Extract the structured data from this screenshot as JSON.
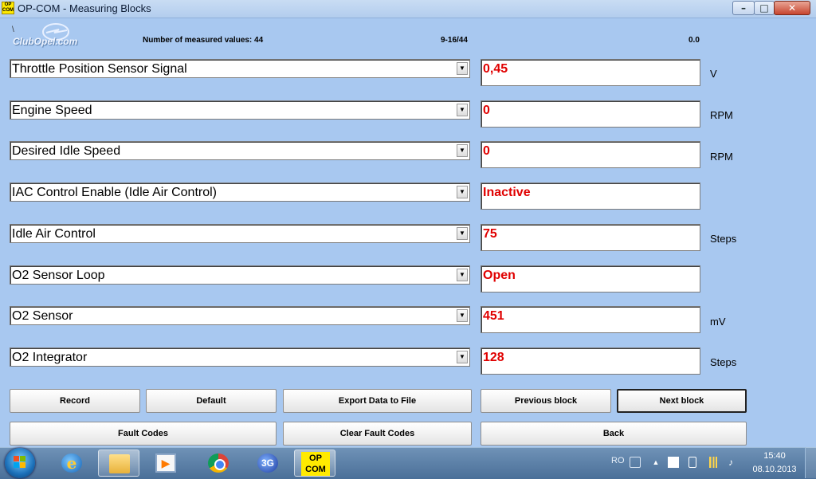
{
  "window": {
    "title": "OP-COM - Measuring Blocks",
    "app_icon": "OP\nCOM",
    "minimize": "–",
    "maximize": "□",
    "close": "✕"
  },
  "header": {
    "logo_text": "ClubOpel.com",
    "logo_mark": "\\",
    "num_measured_label": "Number of measured values: 44",
    "range_label": "9-16/44",
    "time_label": "0.0"
  },
  "rows": [
    {
      "name": "Throttle Position Sensor Signal",
      "value": "0,45",
      "unit": "V"
    },
    {
      "name": "Engine Speed",
      "value": "0",
      "unit": "RPM"
    },
    {
      "name": "Desired Idle Speed",
      "value": "0",
      "unit": "RPM"
    },
    {
      "name": "IAC Control Enable (Idle Air Control)",
      "value": "Inactive",
      "unit": ""
    },
    {
      "name": "Idle Air Control",
      "value": "75",
      "unit": "Steps"
    },
    {
      "name": "O2 Sensor Loop",
      "value": "Open",
      "unit": ""
    },
    {
      "name": "O2 Sensor",
      "value": "451",
      "unit": "mV"
    },
    {
      "name": "O2 Integrator",
      "value": "128",
      "unit": "Steps"
    }
  ],
  "dropdown_arrow": "▼",
  "buttons": {
    "record": "Record",
    "default": "Default",
    "export": "Export Data to File",
    "previous": "Previous block",
    "next": "Next block",
    "fault_codes": "Fault Codes",
    "clear_fault_codes": "Clear Fault Codes",
    "back": "Back"
  },
  "taskbar": {
    "items": [
      "windows-start",
      "internet-explorer",
      "file-explorer",
      "media-player",
      "chrome",
      "3g-modem",
      "op-com"
    ],
    "ie_glyph": "e",
    "media_glyph": "▶",
    "g3_label": "3G",
    "opcom_label": "OP\nCOM",
    "language": "RO",
    "tray_arrow": "▲",
    "volume_glyph": "♪",
    "clock_time": "15:40",
    "clock_date": "08.10.2013"
  }
}
